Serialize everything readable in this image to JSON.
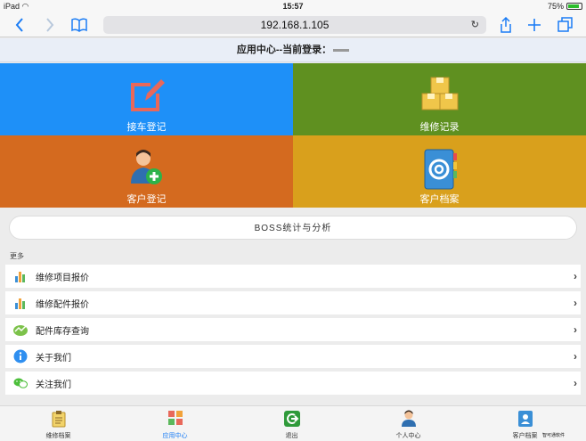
{
  "status_bar": {
    "device": "iPad",
    "wifi_icon": "wifi-icon",
    "time": "15:57",
    "battery": "75%"
  },
  "browser": {
    "url": "192.168.1.105"
  },
  "header": {
    "title": "应用中心--当前登录："
  },
  "tiles": [
    {
      "label": "接车登记",
      "color": "#1e90f8",
      "icon": "edit-icon"
    },
    {
      "label": "维修记录",
      "color": "#5f9020",
      "icon": "boxes-icon"
    },
    {
      "label": "客户登记",
      "color": "#d46a1f",
      "icon": "add-user-icon"
    },
    {
      "label": "客户档案",
      "color": "#d9a01c",
      "icon": "contact-book-icon"
    }
  ],
  "boss_button": "BOSS统计与分析",
  "more_label": "更多",
  "list": [
    {
      "label": "维修项目报价",
      "icon": "bar-chart-icon"
    },
    {
      "label": "维修配件报价",
      "icon": "bar-chart-icon"
    },
    {
      "label": "配件库存查询",
      "icon": "inventory-icon"
    },
    {
      "label": "关于我们",
      "icon": "info-icon"
    },
    {
      "label": "关注我们",
      "icon": "wechat-icon"
    }
  ],
  "tabs": [
    {
      "label": "维修档案",
      "active": false
    },
    {
      "label": "应用中心",
      "active": true
    },
    {
      "label": "退出",
      "active": false
    },
    {
      "label": "个人中心",
      "active": false
    },
    {
      "label": "客户档案",
      "active": false
    }
  ],
  "watermark": "智可通软件"
}
